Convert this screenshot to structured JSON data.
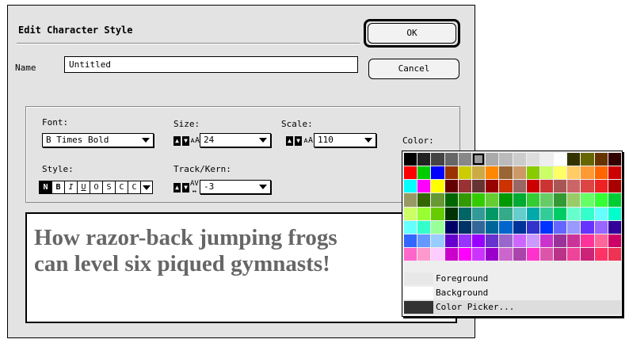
{
  "dialog": {
    "title": "Edit Character Style",
    "name_label": "Name",
    "name_value": "Untitled",
    "ok_label": "OK",
    "cancel_label": "Cancel"
  },
  "font": {
    "label": "Font:",
    "value": "B Times Bold"
  },
  "size": {
    "label": "Size:",
    "value": "24"
  },
  "scale": {
    "label": "Scale:",
    "value": "110"
  },
  "color": {
    "label": "Color:"
  },
  "style": {
    "label": "Style:",
    "buttons": [
      "N",
      "B",
      "I",
      "U",
      "O",
      "S",
      "C",
      "C"
    ]
  },
  "track": {
    "label": "Track/Kern:",
    "value": "-3"
  },
  "sample": {
    "line1": "How razor-back jumping frogs",
    "line2": "can level six piqued gymnasts!"
  },
  "palette": {
    "options": [
      "Foreground",
      "Background",
      "Color Picker..."
    ],
    "colors": [
      [
        "#000000",
        "#222222",
        "#444444",
        "#666666",
        "#888888",
        "#999999",
        "#aaaaaa",
        "#bbbbbb",
        "#cccccc",
        "#dddddd",
        "#eeeeee",
        "#ffffff",
        "#333300",
        "#666600",
        "#663300",
        "#330000"
      ],
      [
        "#ff0000",
        "#00cc00",
        "#0000ff",
        "#993300",
        "#cccc00",
        "#ccaa44",
        "#ff8800",
        "#996633",
        "#cc9966",
        "#88cc00",
        "#ccff66",
        "#ffff66",
        "#ffcc66",
        "#ff9933",
        "#ff6600",
        "#cc0000"
      ],
      [
        "#00ffff",
        "#ff00ff",
        "#ffff00",
        "#660000",
        "#993333",
        "#663333",
        "#990000",
        "#cc3300",
        "#996666",
        "#cc0000",
        "#cc3333",
        "#aa5555",
        "#cc6666",
        "#dd4444",
        "#ee2222",
        "#aa0000"
      ],
      [
        "#999966",
        "#336600",
        "#669933",
        "#006600",
        "#339900",
        "#33cc00",
        "#66cc33",
        "#009900",
        "#00aa33",
        "#33cc33",
        "#66cc66",
        "#339933",
        "#99cc66",
        "#66ff66",
        "#33ff33",
        "#00cc33"
      ],
      [
        "#ccff66",
        "#99ff33",
        "#66cc00",
        "#003300",
        "#006666",
        "#339999",
        "#009966",
        "#33aa88",
        "#66cccc",
        "#00aaaa",
        "#33cc99",
        "#00cc66",
        "#66ffcc",
        "#33ffcc",
        "#66ffff",
        "#00ffcc"
      ],
      [
        "#66ffff",
        "#33ffcc",
        "#99ff99",
        "#000066",
        "#003366",
        "#336699",
        "#006699",
        "#0066cc",
        "#003399",
        "#3333cc",
        "#0033ff",
        "#6666ff",
        "#9999ff",
        "#6633ff",
        "#9966ff",
        "#330099"
      ],
      [
        "#3366ff",
        "#6699ff",
        "#99ccff",
        "#6600cc",
        "#9933ff",
        "#9900ff",
        "#6633cc",
        "#9966cc",
        "#cc66ff",
        "#cc99ff",
        "#cc33cc",
        "#993399",
        "#cc3399",
        "#ff3399",
        "#ff6699",
        "#cc0066"
      ],
      [
        "#ff66cc",
        "#ff99cc",
        "#ffccff",
        "#cc00cc",
        "#ff00ff",
        "#cc33ff",
        "#9900cc",
        "#cc66cc",
        "#aa44aa",
        "#ff33cc",
        "#dd55aa",
        "#bb3388",
        "#ee4499",
        "#cc2277",
        "#ff3366",
        "#ee3355"
      ]
    ]
  }
}
